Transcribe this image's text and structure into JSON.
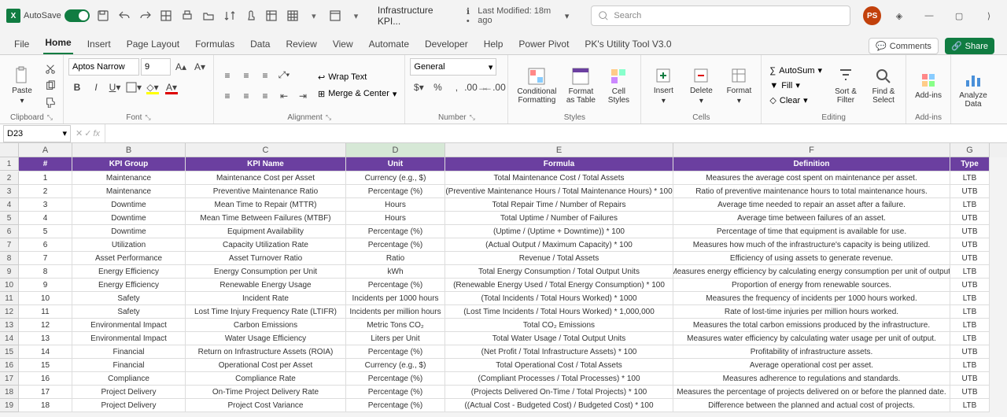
{
  "title_bar": {
    "autosave": "AutoSave",
    "doc_title": "Infrastructure KPI...",
    "last_modified": "Last Modified: 18m ago",
    "search_placeholder": "Search",
    "avatar": "PS"
  },
  "tabs": {
    "file": "File",
    "home": "Home",
    "insert": "Insert",
    "page_layout": "Page Layout",
    "formulas": "Formulas",
    "data": "Data",
    "review": "Review",
    "view": "View",
    "automate": "Automate",
    "developer": "Developer",
    "help": "Help",
    "power_pivot": "Power Pivot",
    "pk_tool": "PK's Utility Tool V3.0",
    "comments": "Comments",
    "share": "Share"
  },
  "ribbon": {
    "paste": "Paste",
    "clipboard": "Clipboard",
    "font_name": "Aptos Narrow",
    "font_size": "9",
    "font": "Font",
    "wrap": "Wrap Text",
    "merge": "Merge & Center",
    "alignment": "Alignment",
    "number_format": "General",
    "number": "Number",
    "cond_fmt": "Conditional Formatting",
    "fmt_table": "Format as Table",
    "cell_styles": "Cell Styles",
    "styles": "Styles",
    "insert": "Insert",
    "delete": "Delete",
    "format": "Format",
    "cells": "Cells",
    "autosum": "AutoSum",
    "fill": "Fill",
    "clear": "Clear",
    "editing": "Editing",
    "sort_filter": "Sort & Filter",
    "find_select": "Find & Select",
    "addins": "Add-ins",
    "addins_label": "Add-ins",
    "analyze": "Analyze Data"
  },
  "fbar": {
    "name": "D23"
  },
  "cols": [
    "A",
    "B",
    "C",
    "D",
    "E",
    "F",
    "G"
  ],
  "headers": {
    "A": "#",
    "B": "KPI Group",
    "C": "KPI Name",
    "D": "Unit",
    "E": "Formula",
    "F": "Definition",
    "G": "Type"
  },
  "rows": [
    {
      "n": 1,
      "g": "Maintenance",
      "k": "Maintenance Cost per Asset",
      "u": "Currency (e.g., $)",
      "f": "Total Maintenance Cost / Total Assets",
      "d": "Measures the average cost spent on maintenance per asset.",
      "t": "LTB"
    },
    {
      "n": 2,
      "g": "Maintenance",
      "k": "Preventive Maintenance Ratio",
      "u": "Percentage (%)",
      "f": "(Preventive Maintenance Hours / Total Maintenance Hours) * 100",
      "d": "Ratio of preventive maintenance hours to total maintenance hours.",
      "t": "UTB"
    },
    {
      "n": 3,
      "g": "Downtime",
      "k": "Mean Time to Repair (MTTR)",
      "u": "Hours",
      "f": "Total Repair Time / Number of Repairs",
      "d": "Average time needed to repair an asset after a failure.",
      "t": "LTB"
    },
    {
      "n": 4,
      "g": "Downtime",
      "k": "Mean Time Between Failures (MTBF)",
      "u": "Hours",
      "f": "Total Uptime / Number of Failures",
      "d": "Average time between failures of an asset.",
      "t": "UTB"
    },
    {
      "n": 5,
      "g": "Downtime",
      "k": "Equipment Availability",
      "u": "Percentage (%)",
      "f": "(Uptime / (Uptime + Downtime)) * 100",
      "d": "Percentage of time that equipment is available for use.",
      "t": "UTB"
    },
    {
      "n": 6,
      "g": "Utilization",
      "k": "Capacity Utilization Rate",
      "u": "Percentage (%)",
      "f": "(Actual Output / Maximum Capacity) * 100",
      "d": "Measures how much of the infrastructure's capacity is being utilized.",
      "t": "UTB"
    },
    {
      "n": 7,
      "g": "Asset Performance",
      "k": "Asset Turnover Ratio",
      "u": "Ratio",
      "f": "Revenue / Total Assets",
      "d": "Efficiency of using assets to generate revenue.",
      "t": "UTB"
    },
    {
      "n": 8,
      "g": "Energy Efficiency",
      "k": "Energy Consumption per Unit",
      "u": "kWh",
      "f": "Total Energy Consumption / Total Output Units",
      "d": "Measures energy efficiency by calculating energy consumption per unit of output.",
      "t": "LTB"
    },
    {
      "n": 9,
      "g": "Energy Efficiency",
      "k": "Renewable Energy Usage",
      "u": "Percentage (%)",
      "f": "(Renewable Energy Used / Total Energy Consumption) * 100",
      "d": "Proportion of energy from renewable sources.",
      "t": "UTB"
    },
    {
      "n": 10,
      "g": "Safety",
      "k": "Incident Rate",
      "u": "Incidents per 1000 hours",
      "f": "(Total Incidents / Total Hours Worked) * 1000",
      "d": "Measures the frequency of incidents per 1000 hours worked.",
      "t": "LTB"
    },
    {
      "n": 11,
      "g": "Safety",
      "k": "Lost Time Injury Frequency Rate (LTIFR)",
      "u": "Incidents per million hours",
      "f": "(Lost Time Incidents / Total Hours Worked) * 1,000,000",
      "d": "Rate of lost-time injuries per million hours worked.",
      "t": "LTB"
    },
    {
      "n": 12,
      "g": "Environmental Impact",
      "k": "Carbon Emissions",
      "u": "Metric Tons CO₂",
      "f": "Total CO₂ Emissions",
      "d": "Measures the total carbon emissions produced by the infrastructure.",
      "t": "LTB"
    },
    {
      "n": 13,
      "g": "Environmental Impact",
      "k": "Water Usage Efficiency",
      "u": "Liters per Unit",
      "f": "Total Water Usage / Total Output Units",
      "d": "Measures water efficiency by calculating water usage per unit of output.",
      "t": "LTB"
    },
    {
      "n": 14,
      "g": "Financial",
      "k": "Return on Infrastructure Assets (ROIA)",
      "u": "Percentage (%)",
      "f": "(Net Profit / Total Infrastructure Assets) * 100",
      "d": "Profitability of infrastructure assets.",
      "t": "UTB"
    },
    {
      "n": 15,
      "g": "Financial",
      "k": "Operational Cost per Asset",
      "u": "Currency (e.g., $)",
      "f": "Total Operational Cost / Total Assets",
      "d": "Average operational cost per asset.",
      "t": "LTB"
    },
    {
      "n": 16,
      "g": "Compliance",
      "k": "Compliance Rate",
      "u": "Percentage (%)",
      "f": "(Compliant Processes / Total Processes) * 100",
      "d": "Measures adherence to regulations and standards.",
      "t": "UTB"
    },
    {
      "n": 17,
      "g": "Project Delivery",
      "k": "On-Time Project Delivery Rate",
      "u": "Percentage (%)",
      "f": "(Projects Delivered On-Time / Total Projects) * 100",
      "d": "Measures the percentage of projects delivered on or before the planned date.",
      "t": "UTB"
    },
    {
      "n": 18,
      "g": "Project Delivery",
      "k": "Project Cost Variance",
      "u": "Percentage (%)",
      "f": "((Actual Cost - Budgeted Cost) / Budgeted Cost) * 100",
      "d": "Difference between the planned and actual cost of projects.",
      "t": "LTB"
    }
  ]
}
